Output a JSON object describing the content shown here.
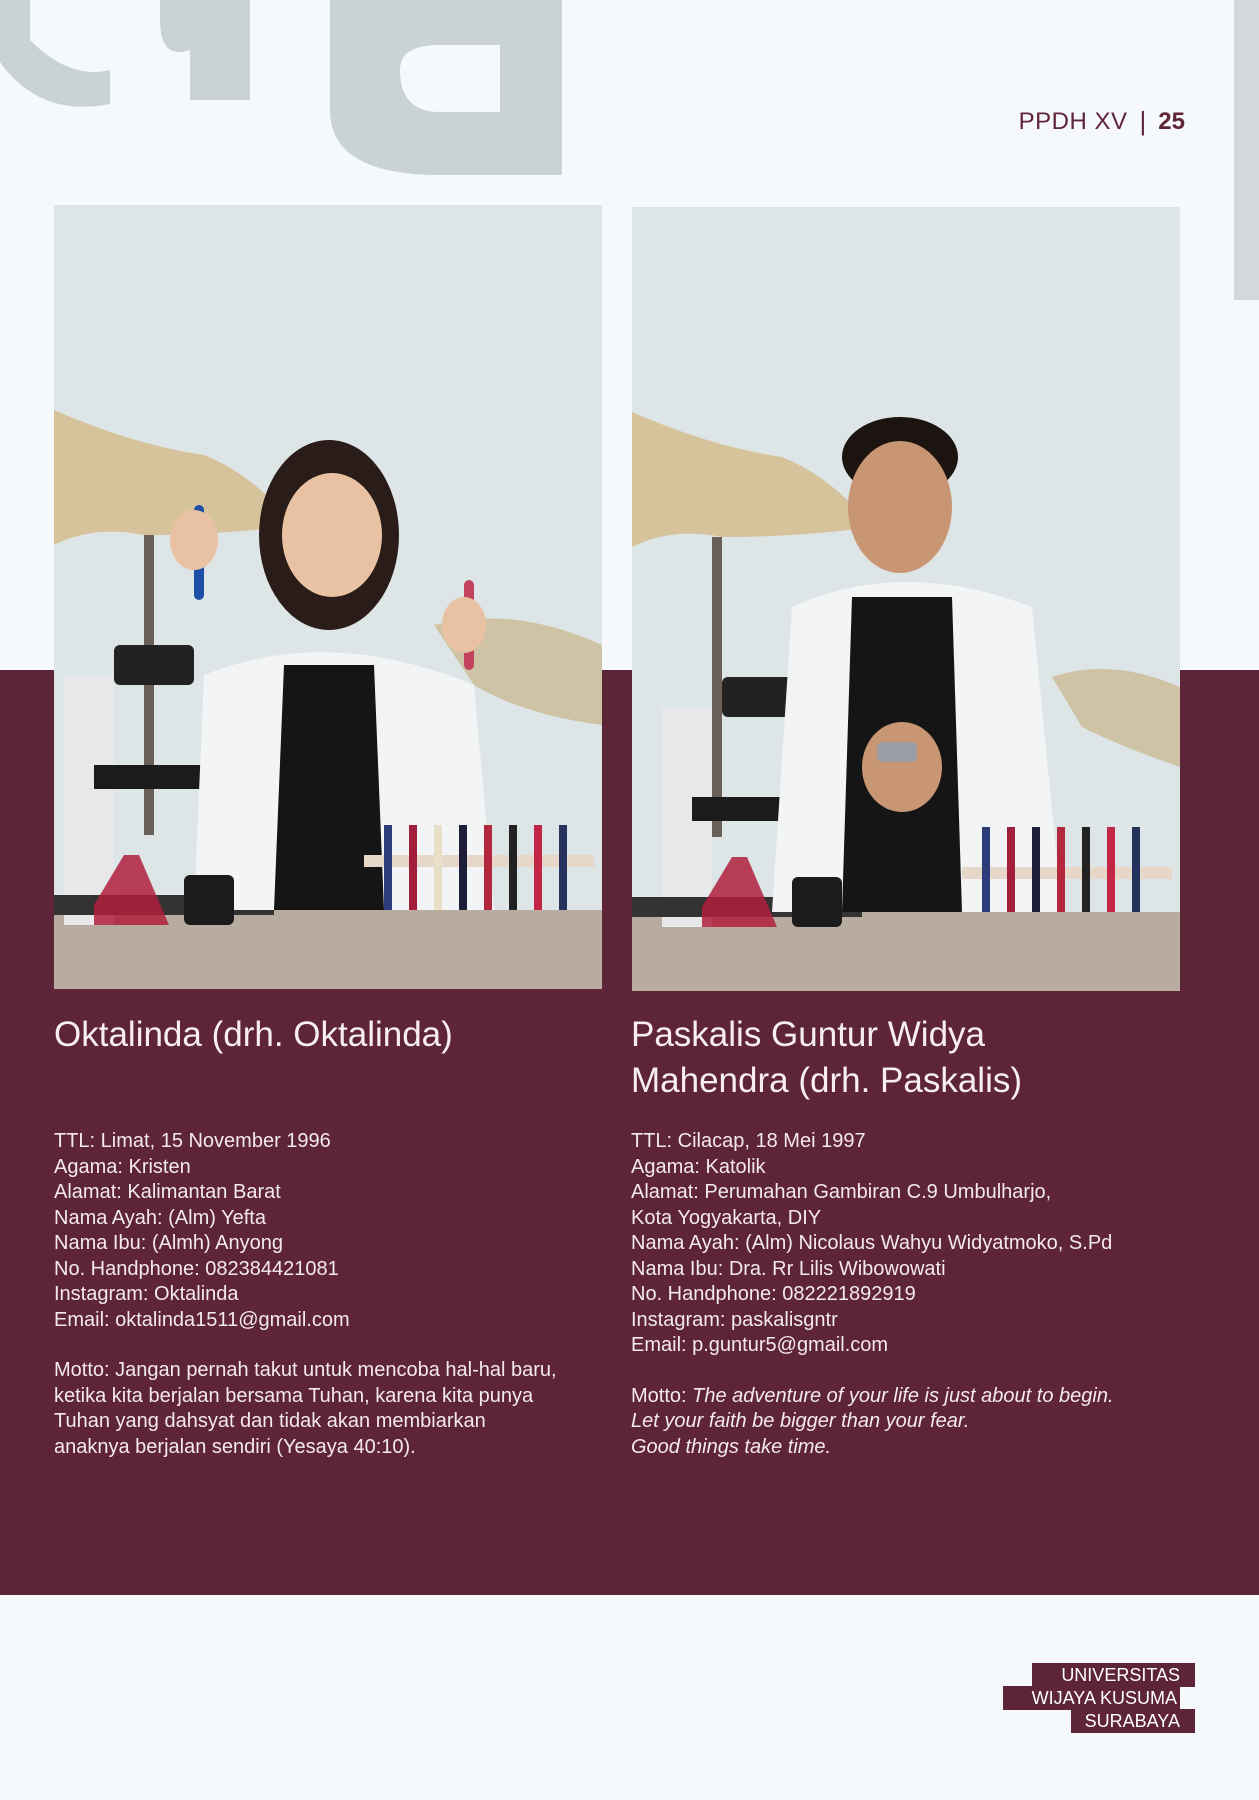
{
  "header": {
    "title": "PPDH XV",
    "separator": "|",
    "page_number": "25"
  },
  "profiles": [
    {
      "name": "Oktalinda (drh. Oktalinda)",
      "name_lines": [
        "Oktalinda (drh. Oktalinda)"
      ],
      "info": [
        "TTL:  Limat, 15 November 1996",
        "Agama: Kristen",
        "Alamat: Kalimantan Barat",
        "Nama Ayah: (Alm) Yefta",
        "Nama Ibu: (Almh) Anyong",
        "No. Handphone: 082384421081",
        "Instagram: Oktalinda",
        "Email: oktalinda1511@gmail.com"
      ],
      "motto_label": "Motto: ",
      "motto_lines": [
        "Jangan pernah takut untuk mencoba hal-hal baru,",
        "ketika kita berjalan bersama Tuhan, karena kita punya",
        "Tuhan yang dahsyat dan tidak akan membiarkan",
        "anaknya berjalan sendiri (Yesaya 40:10)."
      ],
      "motto_italic": false
    },
    {
      "name": "Paskalis Guntur Widya Mahendra (drh. Paskalis)",
      "name_lines": [
        "Paskalis Guntur Widya",
        "Mahendra (drh. Paskalis)"
      ],
      "info": [
        "TTL: Cilacap, 18 Mei 1997",
        "Agama: Katolik",
        "Alamat: Perumahan Gambiran C.9 Umbulharjo,",
        "Kota Yogyakarta, DIY",
        "Nama Ayah: (Alm) Nicolaus Wahyu Widyatmoko, S.Pd",
        "Nama Ibu: Dra. Rr Lilis Wibowowati",
        "No. Handphone: 082221892919",
        "Instagram: paskalisgntr",
        "Email: p.guntur5@gmail.com"
      ],
      "motto_label": "Motto: ",
      "motto_lines": [
        "The adventure of your life is just about to begin.",
        "Let your faith be bigger than your fear.",
        "Good things take time."
      ],
      "motto_italic": true
    }
  ],
  "logo": {
    "lines": [
      "UNIVERSITAS",
      "WIJAYA KUSUMA",
      "SURABAYA"
    ]
  },
  "colors": {
    "maroon": "#5e2438",
    "background": "#f6f9fc",
    "deco_gray": "#c9d3d3"
  }
}
